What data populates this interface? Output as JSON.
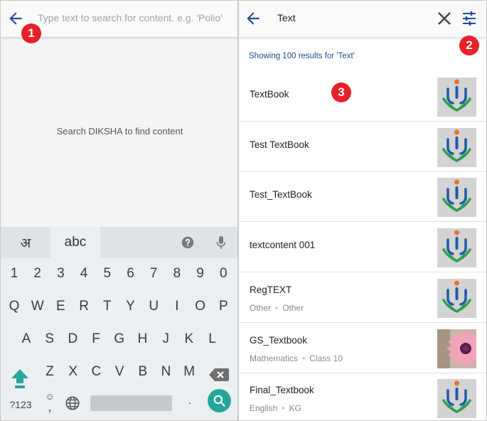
{
  "left_screen": {
    "search": {
      "placeholder": "Type text to search for content. e.g. 'Polio'",
      "value": ""
    },
    "empty_message": "Search DIKSHA to find content",
    "keyboard": {
      "tabs": [
        "अ",
        "abc"
      ],
      "rows": [
        [
          "1",
          "2",
          "3",
          "4",
          "5",
          "6",
          "7",
          "8",
          "9",
          "0"
        ],
        [
          "Q",
          "W",
          "E",
          "R",
          "T",
          "Y",
          "U",
          "I",
          "O",
          "P"
        ],
        [
          "A",
          "S",
          "D",
          "F",
          "G",
          "H",
          "J",
          "K",
          "L"
        ],
        [
          "Z",
          "X",
          "C",
          "V",
          "B",
          "N",
          "M"
        ]
      ],
      "symbols_key": "?123",
      "emoji_key_top": "☺",
      "emoji_key_bottom": ",",
      "period_key": ".",
      "icons": {
        "help": "help-icon",
        "mic": "mic-icon",
        "shift": "shift-icon",
        "backspace": "backspace-icon",
        "globe": "globe-icon",
        "search": "search-icon"
      },
      "accent_color": "#26a69a"
    }
  },
  "right_screen": {
    "search_query": "Text",
    "results_summary": "Showing 100 results for 'Text'",
    "icons": {
      "back": "back-arrow-icon",
      "clear": "close-icon",
      "filter": "filter-sliders-icon"
    },
    "results": [
      {
        "title": "TextBook",
        "meta": [],
        "thumbnail": "diksha-logo"
      },
      {
        "title": "Test TextBook",
        "meta": [],
        "thumbnail": "diksha-logo"
      },
      {
        "title": "Test_TextBook",
        "meta": [],
        "thumbnail": "diksha-logo"
      },
      {
        "title": "textcontent 001",
        "meta": [],
        "thumbnail": "diksha-logo"
      },
      {
        "title": "RegTEXT",
        "meta": [
          "Other",
          "Other"
        ],
        "thumbnail": "diksha-logo"
      },
      {
        "title": "GS_Textbook",
        "meta": [
          "Mathematics",
          "Class 10"
        ],
        "thumbnail": "flower-photo"
      },
      {
        "title": "Final_Textbook",
        "meta": [
          "English",
          "KG"
        ],
        "thumbnail": "diksha-logo"
      }
    ],
    "meta_separator": "•"
  },
  "markers": [
    "1",
    "2",
    "3"
  ],
  "colors": {
    "back_arrow": "#1e4e9c",
    "marker": "#e8202a",
    "summary_text": "#1d4f91",
    "logo_blue": "#1e5aa8",
    "logo_green": "#2e9e4f",
    "logo_orange": "#e8722a"
  }
}
